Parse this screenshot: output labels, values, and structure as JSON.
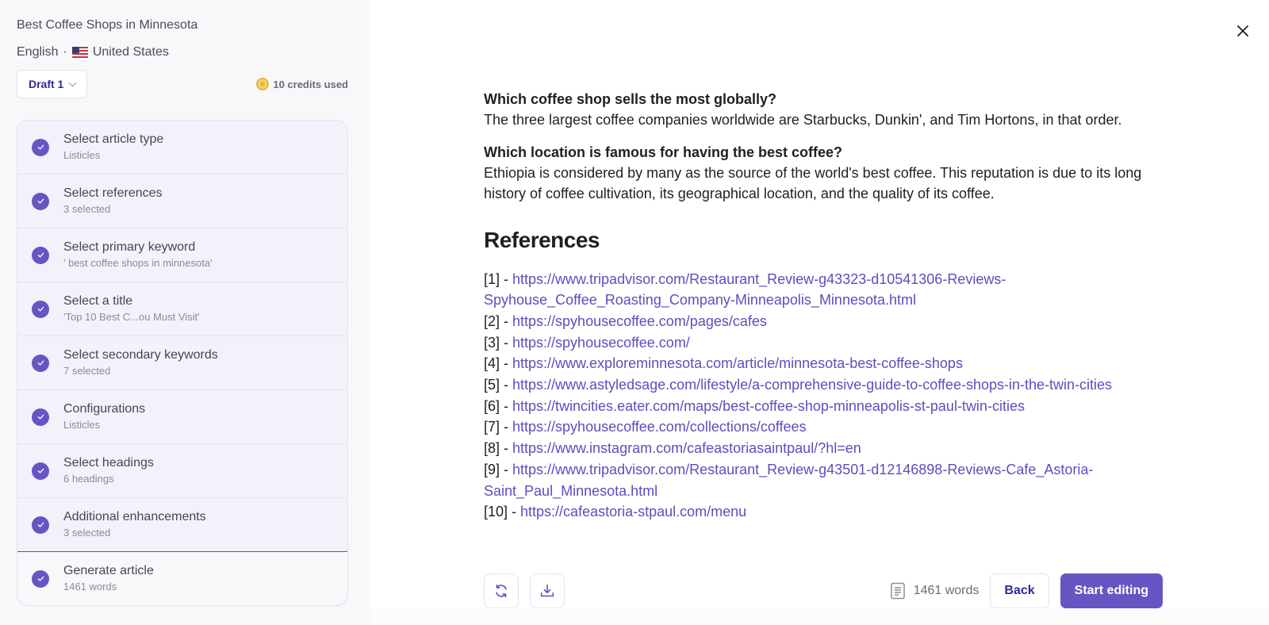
{
  "sidebar": {
    "doc_title": "Best Coffee Shops in Minnesota",
    "language": "English",
    "separator": "·",
    "country": "United States",
    "draft_label": "Draft 1",
    "credits_label": "10 credits used",
    "steps": [
      {
        "title": "Select article type",
        "subtitle": "Listicles",
        "status": "done"
      },
      {
        "title": "Select references",
        "subtitle": "3 selected",
        "status": "done"
      },
      {
        "title": "Select primary keyword",
        "subtitle": "' best coffee shops in minnesota'",
        "status": "done"
      },
      {
        "title": "Select a title",
        "subtitle": "'Top 10 Best C...ou Must Visit'",
        "status": "done"
      },
      {
        "title": "Select secondary keywords",
        "subtitle": "7 selected",
        "status": "done"
      },
      {
        "title": "Configurations",
        "subtitle": "Listicles",
        "status": "done"
      },
      {
        "title": "Select headings",
        "subtitle": "6 headings",
        "status": "done"
      },
      {
        "title": "Additional enhancements",
        "subtitle": "3 selected",
        "status": "done"
      },
      {
        "title": "Generate article",
        "subtitle": "1461 words",
        "status": "active"
      }
    ]
  },
  "article": {
    "faq": [
      {
        "question": "Which coffee shop sells the most globally?",
        "answer": "The three largest coffee companies worldwide are Starbucks, Dunkin', and Tim Hortons, in that order."
      },
      {
        "question": "Which location is famous for having the best coffee?",
        "answer": "Ethiopia is considered by many as the source of the world's best coffee. This reputation is due to its long history of coffee cultivation, its geographical location, and the quality of its coffee."
      }
    ],
    "references_heading": "References",
    "references": [
      {
        "num": "[1] - ",
        "url": "https://www.tripadvisor.com/Restaurant_Review-g43323-d10541306-Reviews-Spyhouse_Coffee_Roasting_Company-Minneapolis_Minnesota.html"
      },
      {
        "num": "[2] - ",
        "url": "https://spyhousecoffee.com/pages/cafes"
      },
      {
        "num": "[3] - ",
        "url": "https://spyhousecoffee.com/"
      },
      {
        "num": "[4] - ",
        "url": "https://www.exploreminnesota.com/article/minnesota-best-coffee-shops"
      },
      {
        "num": "[5] - ",
        "url": "https://www.astyledsage.com/lifestyle/a-comprehensive-guide-to-coffee-shops-in-the-twin-cities"
      },
      {
        "num": "[6] - ",
        "url": "https://twincities.eater.com/maps/best-coffee-shop-minneapolis-st-paul-twin-cities"
      },
      {
        "num": "[7] - ",
        "url": "https://spyhousecoffee.com/collections/coffees"
      },
      {
        "num": "[8] - ",
        "url": "https://www.instagram.com/cafeastoriasaintpaul/?hl=en"
      },
      {
        "num": "[9] - ",
        "url": "https://www.tripadvisor.com/Restaurant_Review-g43501-d12146898-Reviews-Cafe_Astoria-Saint_Paul_Minnesota.html"
      },
      {
        "num": "[10] - ",
        "url": "https://cafeastoria-stpaul.com/menu"
      }
    ]
  },
  "footer": {
    "regenerate_icon": "refresh-icon",
    "download_icon": "download-icon",
    "word_count": "1461 words",
    "back_label": "Back",
    "start_label": "Start editing"
  },
  "colors": {
    "accent": "#6556c4",
    "link": "#5a4fc0",
    "accent_text": "#2e2a9a",
    "coin": "#e3b73a"
  }
}
